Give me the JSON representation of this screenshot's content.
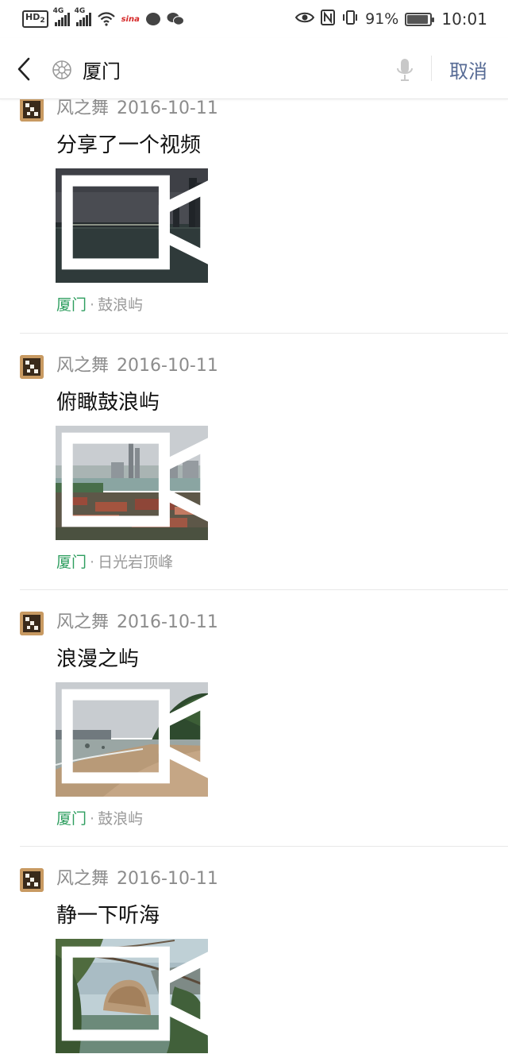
{
  "status_bar": {
    "hd_label": "HD",
    "hd_sub": "2",
    "signal1_tag": "4G",
    "signal2_tag": "4G",
    "sina_label": "sina",
    "battery_percent": "91%",
    "battery_level": 0.91,
    "time": "10:01"
  },
  "search": {
    "query": "厦门",
    "cancel_label": "取消"
  },
  "posts": [
    {
      "author": "风之舞",
      "date": "2016-10-11",
      "title": "分享了一个视频",
      "city": "厦门",
      "place": "鼓浪屿",
      "thumb_scene": "night-harbor"
    },
    {
      "author": "风之舞",
      "date": "2016-10-11",
      "title": "俯瞰鼓浪屿",
      "city": "厦门",
      "place": "日光岩顶峰",
      "thumb_scene": "city-overview"
    },
    {
      "author": "风之舞",
      "date": "2016-10-11",
      "title": "浪漫之屿",
      "city": "厦门",
      "place": "鼓浪屿",
      "thumb_scene": "beach"
    },
    {
      "author": "风之舞",
      "date": "2016-10-11",
      "title": "静一下听海",
      "city": "",
      "place": "",
      "thumb_scene": "rock-view"
    }
  ],
  "colors": {
    "location_city": "#2e9e5f",
    "cancel": "#576b95",
    "meta_gray": "#8c8c8c"
  },
  "separator_dot": "·"
}
